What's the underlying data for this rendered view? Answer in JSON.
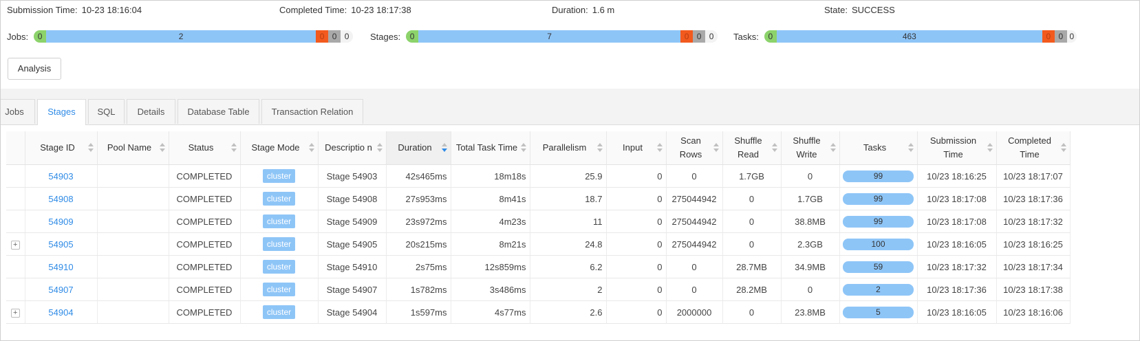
{
  "summary": {
    "submission_label": "Submission Time:",
    "submission_value": "10-23 18:16:04",
    "completed_label": "Completed Time:",
    "completed_value": "10-23 18:17:38",
    "duration_label": "Duration:",
    "duration_value": "1.6 m",
    "state_label": "State:",
    "state_value": "SUCCESS"
  },
  "progress": {
    "jobs": {
      "label": "Jobs:",
      "s0": "0",
      "main": "2",
      "s2": "0",
      "s3": "0",
      "s4": "0"
    },
    "stages": {
      "label": "Stages:",
      "s0": "0",
      "main": "7",
      "s2": "0",
      "s3": "0",
      "s4": "0"
    },
    "tasks": {
      "label": "Tasks:",
      "s0": "0",
      "main": "463",
      "s2": "0",
      "s3": "0",
      "s4": "0"
    }
  },
  "actions": {
    "analysis": "Analysis"
  },
  "tabs": [
    "Jobs",
    "Stages",
    "SQL",
    "Details",
    "Database Table",
    "Transaction Relation"
  ],
  "active_tab": "Stages",
  "table": {
    "headers": {
      "stage_id": "Stage ID",
      "pool_name": "Pool Name",
      "status": "Status",
      "stage_mode": "Stage Mode",
      "description": "Descriptio n",
      "duration": "Duration",
      "total_task_time": "Total Task Time",
      "parallelism": "Parallelism",
      "input": "Input",
      "scan_rows": "Scan Rows",
      "shuffle_read": "Shuffle Read",
      "shuffle_write": "Shuffle Write",
      "tasks": "Tasks",
      "submission_time": "Submission Time",
      "completed_time": "Completed Time"
    },
    "rows": [
      {
        "expand": "",
        "stage_id": "54903",
        "pool_name": "",
        "status": "COMPLETED",
        "mode": "cluster",
        "description": "Stage 54903",
        "duration": "42s465ms",
        "total_task_time": "18m18s",
        "parallelism": "25.9",
        "input": "0",
        "scan_rows": "0",
        "shuffle_read": "1.7GB",
        "shuffle_write": "0",
        "tasks": "99",
        "submission_time": "10/23 18:16:25",
        "completed_time": "10/23 18:17:07"
      },
      {
        "expand": "",
        "stage_id": "54908",
        "pool_name": "",
        "status": "COMPLETED",
        "mode": "cluster",
        "description": "Stage 54908",
        "duration": "27s953ms",
        "total_task_time": "8m41s",
        "parallelism": "18.7",
        "input": "0",
        "scan_rows": "275044942",
        "shuffle_read": "0",
        "shuffle_write": "1.7GB",
        "tasks": "99",
        "submission_time": "10/23 18:17:08",
        "completed_time": "10/23 18:17:36"
      },
      {
        "expand": "",
        "stage_id": "54909",
        "pool_name": "",
        "status": "COMPLETED",
        "mode": "cluster",
        "description": "Stage 54909",
        "duration": "23s972ms",
        "total_task_time": "4m23s",
        "parallelism": "11",
        "input": "0",
        "scan_rows": "275044942",
        "shuffle_read": "0",
        "shuffle_write": "38.8MB",
        "tasks": "99",
        "submission_time": "10/23 18:17:08",
        "completed_time": "10/23 18:17:32"
      },
      {
        "expand": "+",
        "stage_id": "54905",
        "pool_name": "",
        "status": "COMPLETED",
        "mode": "cluster",
        "description": "Stage 54905",
        "duration": "20s215ms",
        "total_task_time": "8m21s",
        "parallelism": "24.8",
        "input": "0",
        "scan_rows": "275044942",
        "shuffle_read": "0",
        "shuffle_write": "2.3GB",
        "tasks": "100",
        "submission_time": "10/23 18:16:05",
        "completed_time": "10/23 18:16:25"
      },
      {
        "expand": "",
        "stage_id": "54910",
        "pool_name": "",
        "status": "COMPLETED",
        "mode": "cluster",
        "description": "Stage 54910",
        "duration": "2s75ms",
        "total_task_time": "12s859ms",
        "parallelism": "6.2",
        "input": "0",
        "scan_rows": "0",
        "shuffle_read": "28.7MB",
        "shuffle_write": "34.9MB",
        "tasks": "59",
        "submission_time": "10/23 18:17:32",
        "completed_time": "10/23 18:17:34"
      },
      {
        "expand": "",
        "stage_id": "54907",
        "pool_name": "",
        "status": "COMPLETED",
        "mode": "cluster",
        "description": "Stage 54907",
        "duration": "1s782ms",
        "total_task_time": "3s486ms",
        "parallelism": "2",
        "input": "0",
        "scan_rows": "0",
        "shuffle_read": "28.2MB",
        "shuffle_write": "0",
        "tasks": "2",
        "submission_time": "10/23 18:17:36",
        "completed_time": "10/23 18:17:38"
      },
      {
        "expand": "+",
        "stage_id": "54904",
        "pool_name": "",
        "status": "COMPLETED",
        "mode": "cluster",
        "description": "Stage 54904",
        "duration": "1s597ms",
        "total_task_time": "4s77ms",
        "parallelism": "2.6",
        "input": "0",
        "scan_rows": "2000000",
        "shuffle_read": "0",
        "shuffle_write": "23.8MB",
        "tasks": "5",
        "submission_time": "10/23 18:16:05",
        "completed_time": "10/23 18:16:06"
      }
    ]
  }
}
